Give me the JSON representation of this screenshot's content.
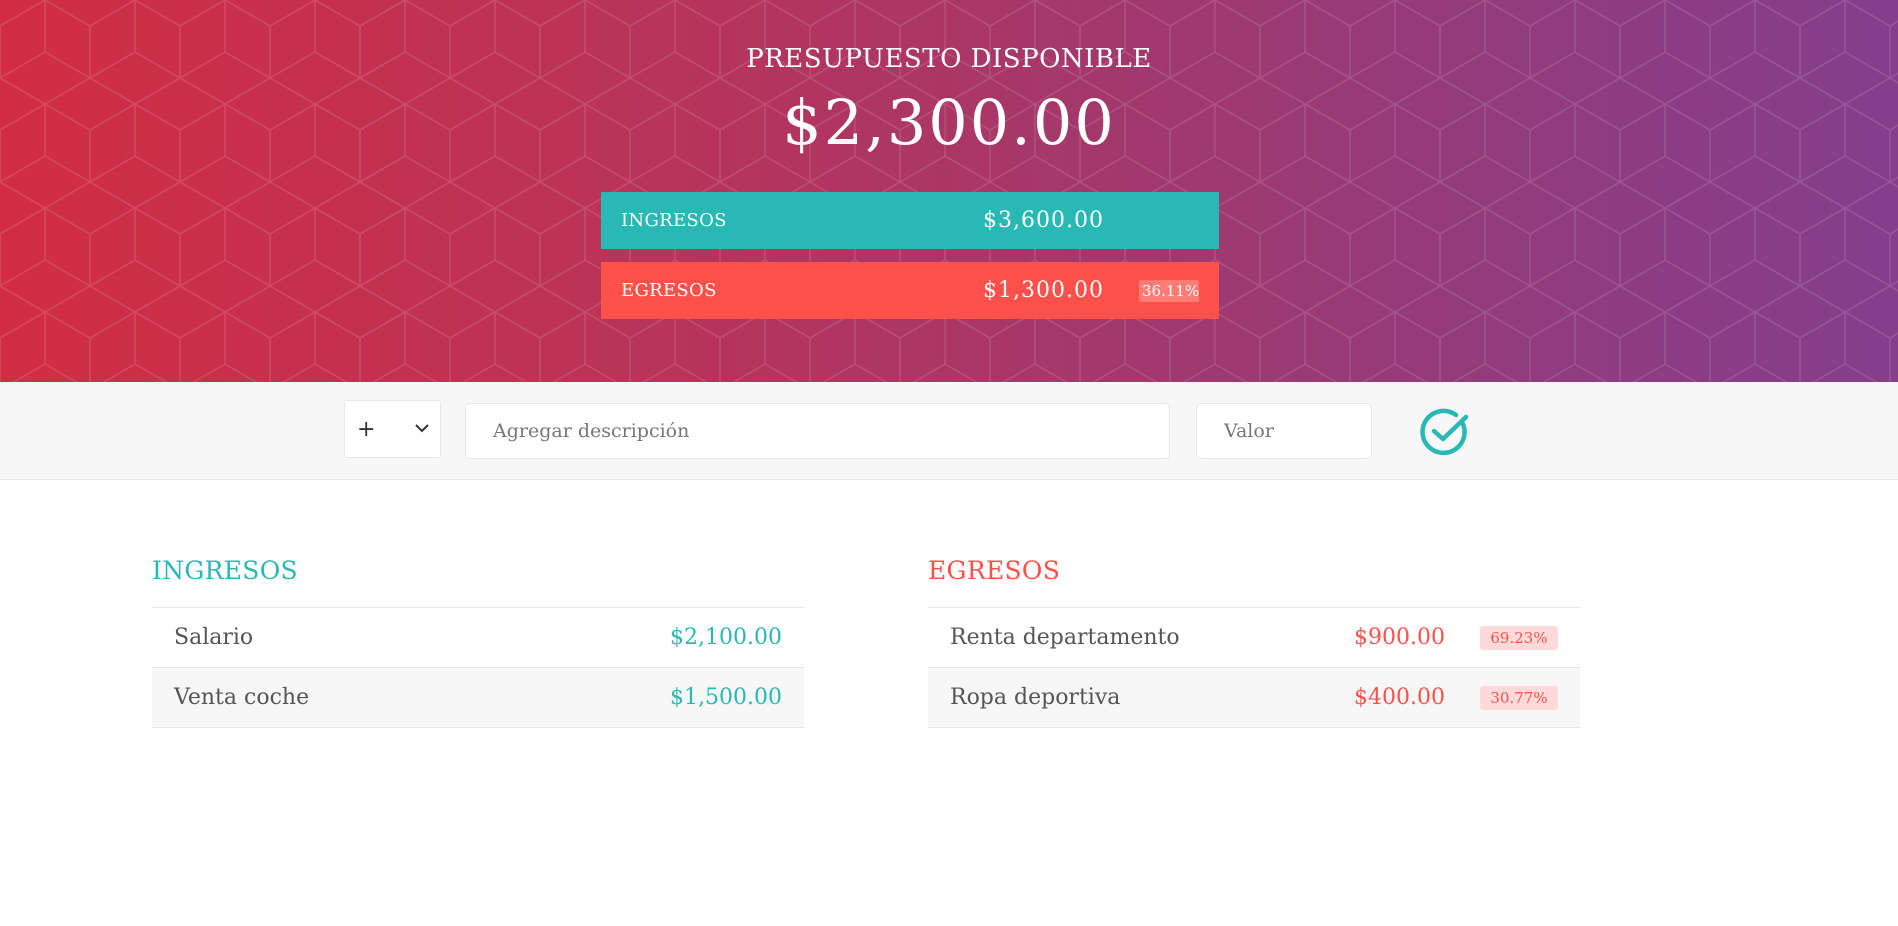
{
  "header": {
    "title": "PRESUPUESTO DISPONIBLE",
    "budget": "$2,300.00",
    "income": {
      "label": "INGRESOS",
      "value": "$3,600.00"
    },
    "expense": {
      "label": "EGRESOS",
      "value": "$1,300.00",
      "percentage": "36.11%"
    },
    "colors": {
      "gradient_start": "#d22d43",
      "gradient_end": "#843e8c",
      "income": "#28b9b5",
      "expense": "#ff5049"
    }
  },
  "add_bar": {
    "type_value": "+",
    "type_options": [
      "+",
      "-"
    ],
    "description_placeholder": "Agregar descripción",
    "value_placeholder": "Valor",
    "submit_icon": "check-circle-icon"
  },
  "incomes": {
    "title": "INGRESOS",
    "items": [
      {
        "description": "Salario",
        "value": "$2,100.00"
      },
      {
        "description": "Venta coche",
        "value": "$1,500.00"
      }
    ]
  },
  "expenses": {
    "title": "EGRESOS",
    "items": [
      {
        "description": "Renta departamento",
        "value": "$900.00",
        "percentage": "69.23%"
      },
      {
        "description": "Ropa deportiva",
        "value": "$400.00",
        "percentage": "30.77%"
      }
    ]
  }
}
